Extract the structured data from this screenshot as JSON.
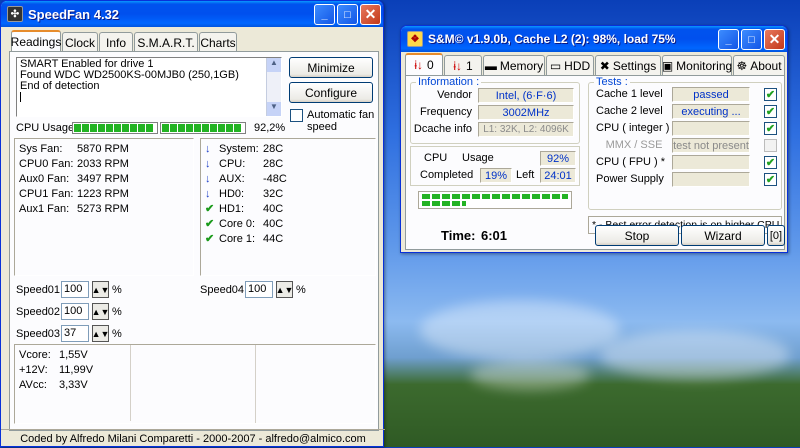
{
  "speedfan": {
    "title": "SpeedFan 4.32",
    "tabs": [
      "Readings",
      "Clock",
      "Info",
      "S.M.A.R.T.",
      "Charts"
    ],
    "log_lines": [
      "SMART Enabled for drive 1",
      "Found WDC WD2500KS-00MJB0 (250,1GB)",
      "End of detection"
    ],
    "minimize_label": "Minimize",
    "configure_label": "Configure",
    "auto_fan_label": "Automatic fan speed",
    "cpu_usage_label": "CPU Usage",
    "cpu_usage_value": "92,2%",
    "fans": [
      {
        "name": "Sys Fan:",
        "value": "5870 RPM"
      },
      {
        "name": "CPU0 Fan:",
        "value": "2033 RPM"
      },
      {
        "name": "Aux0 Fan:",
        "value": "3497 RPM"
      },
      {
        "name": "CPU1 Fan:",
        "value": "1223 RPM"
      },
      {
        "name": "Aux1 Fan:",
        "value": "5273 RPM"
      }
    ],
    "temps": [
      {
        "name": "System:",
        "value": "28C",
        "status": "down"
      },
      {
        "name": "CPU:",
        "value": "28C",
        "status": "down"
      },
      {
        "name": "AUX:",
        "value": "-48C",
        "status": "down"
      },
      {
        "name": "HD0:",
        "value": "32C",
        "status": "down"
      },
      {
        "name": "HD1:",
        "value": "40C",
        "status": "ok"
      },
      {
        "name": "Core 0:",
        "value": "40C",
        "status": "ok"
      },
      {
        "name": "Core 1:",
        "value": "44C",
        "status": "ok"
      }
    ],
    "speeds": [
      {
        "name": "Speed01:",
        "value": "100"
      },
      {
        "name": "Speed02:",
        "value": "100"
      },
      {
        "name": "Speed03:",
        "value": "37"
      },
      {
        "name": "Speed04:",
        "value": "100"
      }
    ],
    "percent_sign": "%",
    "voltages": [
      {
        "name": "Vcore:",
        "value": "1,55V"
      },
      {
        "name": "+12V:",
        "value": "11,99V"
      },
      {
        "name": "AVcc:",
        "value": "3,33V"
      }
    ],
    "footer": "Coded by Alfredo Milani Comparetti - 2000-2007 - alfredo@almico.com"
  },
  "sm": {
    "title": "S&M© v1.9.0b, Cache L2 (2): 98%, load 75%",
    "tabs": [
      "0",
      "1",
      "Memory",
      "HDD",
      "Settings",
      "Monitoring",
      "About"
    ],
    "information_label": "Information :",
    "vendor_label": "Vendor",
    "vendor_value": "Intel, (6·F·6)",
    "frequency_label": "Frequency",
    "frequency_value": "3002MHz",
    "dcache_label": "Dcache info",
    "dcache_value": "L1: 32K, L2: 4096K",
    "cpu_label": "CPU",
    "usage_label": "Usage",
    "usage_value": "92%",
    "completed_label": "Completed",
    "completed_value": "19%",
    "left_label": "Left",
    "left_value": "24:01",
    "tests_label": "Tests :",
    "tests": [
      {
        "name": "Cache 1 level",
        "value": "passed",
        "checked": true,
        "enabled": true
      },
      {
        "name": "Cache 2 level",
        "value": "executing ...",
        "checked": true,
        "enabled": true
      },
      {
        "name": "CPU ( integer )",
        "value": "",
        "checked": true,
        "enabled": true
      },
      {
        "name": "MMX / SSE",
        "value": "test not present",
        "checked": false,
        "enabled": false
      },
      {
        "name": "CPU ( FPU ) *",
        "value": "",
        "checked": true,
        "enabled": true
      },
      {
        "name": "Power Supply",
        "value": "",
        "checked": true,
        "enabled": true
      }
    ],
    "note": "* - Best error detection is on higher CPU load",
    "time_label": "Time:",
    "time_value": "6:01",
    "stop_label": "Stop",
    "wizard_label": "Wizard",
    "bracket_label": "[0]",
    "progress_fraction": 0.19
  }
}
